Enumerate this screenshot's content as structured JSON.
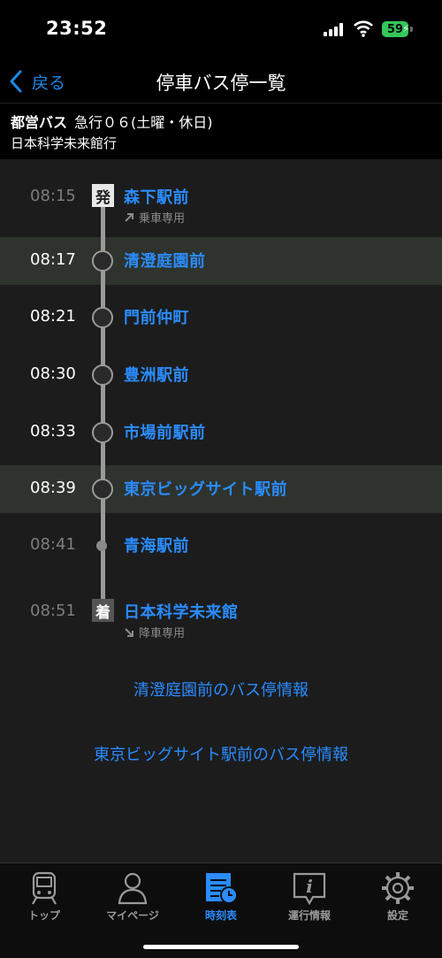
{
  "status": {
    "time": "23:52",
    "battery": "59"
  },
  "nav": {
    "back_label": "戻る",
    "title": "停車バス停一覧"
  },
  "route": {
    "operator": "都営バス",
    "route_name": "急行０６(土曜・休日)",
    "destination": "日本科学未来館行"
  },
  "stops": [
    {
      "time": "08:15",
      "name": "森下駅前",
      "badge": "発",
      "note": "乗車専用"
    },
    {
      "time": "08:17",
      "name": "清澄庭園前"
    },
    {
      "time": "08:21",
      "name": "門前仲町"
    },
    {
      "time": "08:30",
      "name": "豊洲駅前"
    },
    {
      "time": "08:33",
      "name": "市場前駅前"
    },
    {
      "time": "08:39",
      "name": "東京ビッグサイト駅前"
    },
    {
      "time": "08:41",
      "name": "青海駅前"
    },
    {
      "time": "08:51",
      "name": "日本科学未来館",
      "badge": "着",
      "note": "降車専用"
    }
  ],
  "links": {
    "stop_info_1": "清澄庭園前のバス停情報",
    "stop_info_2": "東京ビッグサイト駅前のバス停情報"
  },
  "tabs": [
    {
      "label": "トップ",
      "icon": "train-icon"
    },
    {
      "label": "マイページ",
      "icon": "person-icon"
    },
    {
      "label": "時刻表",
      "icon": "timetable-icon",
      "active": true
    },
    {
      "label": "運行情報",
      "icon": "info-icon"
    },
    {
      "label": "設定",
      "icon": "gear-icon"
    }
  ],
  "colors": {
    "accent": "#2a8cff",
    "highlight_row": "#2e332d",
    "battery": "#34c759"
  }
}
